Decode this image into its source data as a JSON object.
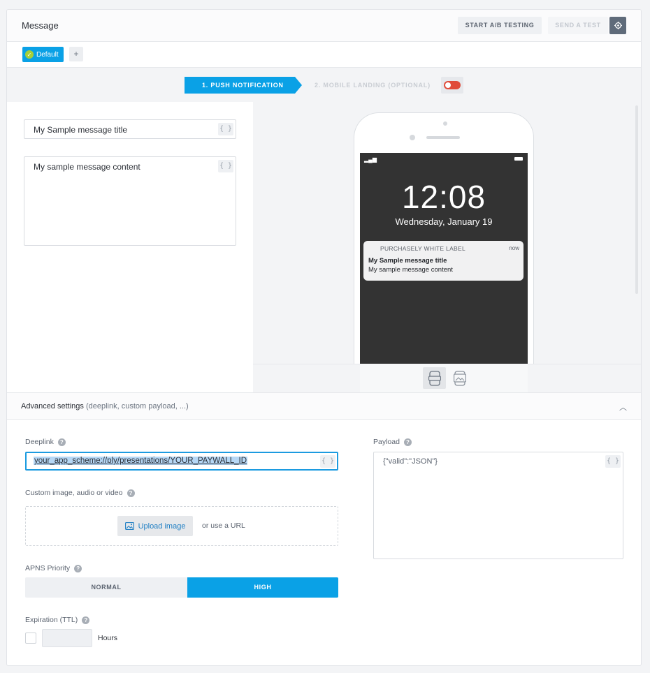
{
  "header": {
    "title": "Message",
    "ab_button": "START A/B TESTING",
    "send_test_button": "SEND A TEST"
  },
  "variants": {
    "default_label": "Default",
    "add_label": "+"
  },
  "steps": {
    "step1": "1. PUSH NOTIFICATION",
    "step2": "2. MOBILE LANDING (OPTIONAL)"
  },
  "editor": {
    "title_value": "My Sample message title",
    "content_value": "My sample message content",
    "braces": "{ }"
  },
  "preview": {
    "time": "12:08",
    "date": "Wednesday, January 19",
    "app_name": "PURCHASELY WHITE LABEL",
    "now": "now",
    "notif_title": "My Sample message title",
    "notif_body": "My sample message content"
  },
  "advanced": {
    "title": "Advanced settings",
    "subtitle": "(deeplink, custom payload, ...)"
  },
  "fields": {
    "deeplink_label": "Deeplink",
    "deeplink_value": "your_app_scheme://ply/presentations/YOUR_PAYWALL_ID",
    "media_label": "Custom image, audio or video",
    "upload_label": "Upload image",
    "or_url": "or use a URL",
    "apns_label": "APNS Priority",
    "prio_normal": "NORMAL",
    "prio_high": "HIGH",
    "expiration_label": "Expiration (TTL)",
    "hours_label": "Hours",
    "payload_label": "Payload",
    "payload_value": "{\"valid\":\"JSON\"}"
  },
  "colors": {
    "accent": "#0aa1e6",
    "toggle_off": "#e04b3a",
    "check_green": "#a6cf3a"
  }
}
